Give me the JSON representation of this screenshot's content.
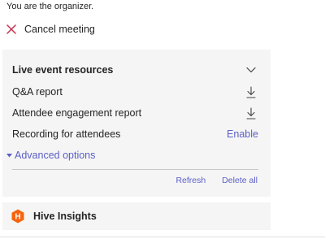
{
  "organizer_text": "You are the organizer.",
  "cancel": {
    "label": "Cancel meeting",
    "icon": "close-icon",
    "icon_color": "#c4314b"
  },
  "resources": {
    "title": "Live event resources",
    "toggle_icon": "chevron-down-icon",
    "items": [
      {
        "label": "Q&A report",
        "action_icon": "download-icon"
      },
      {
        "label": "Attendee engagement report",
        "action_icon": "download-icon"
      },
      {
        "label": "Recording for attendees",
        "action_label": "Enable"
      }
    ],
    "advanced_label": "Advanced options",
    "refresh_label": "Refresh",
    "delete_all_label": "Delete all"
  },
  "hive": {
    "name": "Hive Insights",
    "logo_letter": "H",
    "logo_color": "#f7630c"
  },
  "colors": {
    "accent": "#5b5fc7",
    "panel_bg": "#f5f5f5"
  }
}
